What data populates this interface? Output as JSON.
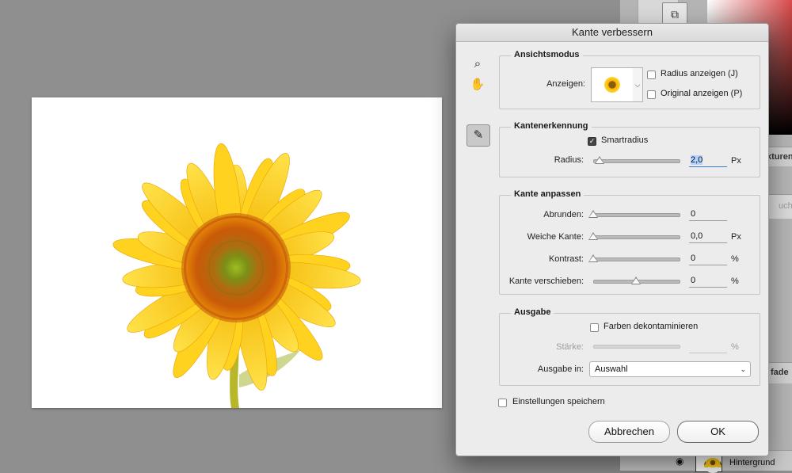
{
  "right_panel": {
    "strip1_text": "kturen",
    "strip2_text": "uchen",
    "strip3_text": "fade",
    "layer_name": "Hintergrund"
  },
  "dialog": {
    "title": "Kante verbessern",
    "ansichtsmodus": {
      "title": "Ansichtsmodus",
      "anzeigen_label": "Anzeigen:",
      "radius_anzeigen": "Radius anzeigen (J)",
      "original_anzeigen": "Original anzeigen (P)",
      "radius_anzeigen_checked": false,
      "original_anzeigen_checked": false
    },
    "kantenerkennung": {
      "title": "Kantenerkennung",
      "smartradius": "Smartradius",
      "smartradius_checked": true,
      "radius_label": "Radius:",
      "radius_value": "2,0",
      "radius_unit": "Px",
      "radius_slider_fraction": 0.07
    },
    "kante_anpassen": {
      "title": "Kante anpassen",
      "rows": [
        {
          "label": "Abrunden:",
          "value": "0",
          "unit": "",
          "fraction": 0.0
        },
        {
          "label": "Weiche Kante:",
          "value": "0,0",
          "unit": "Px",
          "fraction": 0.0
        },
        {
          "label": "Kontrast:",
          "value": "0",
          "unit": "%",
          "fraction": 0.0
        },
        {
          "label": "Kante verschieben:",
          "value": "0",
          "unit": "%",
          "fraction": 0.5
        }
      ]
    },
    "ausgabe": {
      "title": "Ausgabe",
      "farben": "Farben dekontaminieren",
      "farben_checked": false,
      "staerke_label": "Stärke:",
      "staerke_unit": "%",
      "ausgabe_in_label": "Ausgabe in:",
      "ausgabe_in_value": "Auswahl"
    },
    "einstellungen": "Einstellungen speichern",
    "einstellungen_checked": false,
    "cancel": "Abbrechen",
    "ok": "OK"
  }
}
